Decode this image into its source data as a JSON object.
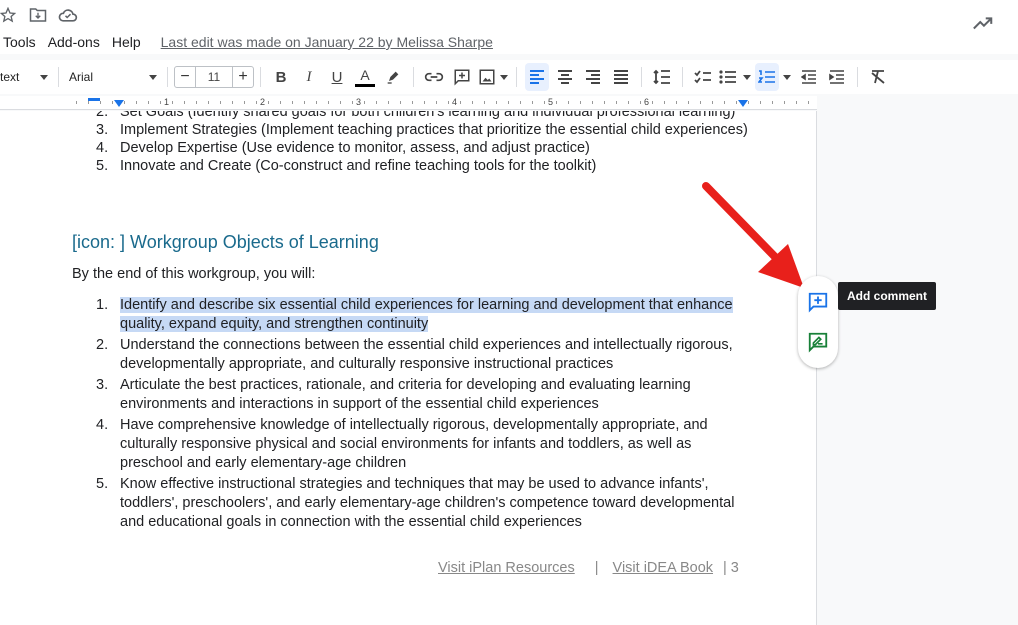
{
  "menu": {
    "items": [
      "Tools",
      "Add-ons",
      "Help"
    ],
    "last_edit": "Last edit was made on January 22 by Melissa Sharpe"
  },
  "toolbar": {
    "style_value": "text",
    "font_value": "Arial",
    "font_size": "11",
    "minus": "−",
    "plus": "+",
    "bold": "B",
    "italic": "I",
    "underline": "U",
    "text_color": "A"
  },
  "ruler": {
    "numbers": [
      "1",
      "2",
      "3",
      "4",
      "5",
      "6"
    ]
  },
  "document": {
    "list_a": [
      {
        "num": "2.",
        "text": "Set Goals (Identify shared goals for both children's learning and individual professional learning)"
      },
      {
        "num": "3.",
        "text": "Implement Strategies (Implement teaching practices that prioritize the essential child experiences)"
      },
      {
        "num": "4.",
        "text": "Develop Expertise (Use evidence to monitor, assess, and adjust practice)"
      },
      {
        "num": "5.",
        "text": "Innovate and Create (Co-construct and refine teaching tools for the toolkit)"
      }
    ],
    "heading": "[icon: ] Workgroup Objects of Learning",
    "intro": "By the end of this workgroup, you will:",
    "list_b": [
      {
        "num": "1.",
        "text": "Identify and describe six essential child experiences for learning and development that enhance quality, expand equity, and strengthen continuity"
      },
      {
        "num": "2.",
        "text": "Understand the connections between the essential child experiences and intellectually rigorous, developmentally appropriate, and culturally responsive instructional practices"
      },
      {
        "num": "3.",
        "text": "Articulate the best practices, rationale, and criteria for developing and evaluating learning environments and interactions in support of the essential child experiences"
      },
      {
        "num": "4.",
        "text": "Have comprehensive knowledge of intellectually rigorous, developmentally appropriate, and culturally responsive physical and social environments for infants and toddlers, as well as preschool and early elementary-age children"
      },
      {
        "num": "5.",
        "text": "Know effective instructional strategies and techniques that may be used to advance infants', toddlers', preschoolers', and early elementary-age children's competence toward developmental and educational goals in connection with the essential child experiences"
      }
    ],
    "footer": {
      "link1": "Visit iPlan Resources",
      "sep": "|",
      "link2": "Visit iDEA Book",
      "page": "| 3"
    }
  },
  "comment_panel": {
    "tooltip": "Add comment"
  },
  "colors": {
    "accent": "#1a73e8",
    "heading": "#1a6a8c",
    "highlight": "#c6d9f5",
    "suggest_green": "#188038",
    "arrow_red": "#e8201b"
  }
}
